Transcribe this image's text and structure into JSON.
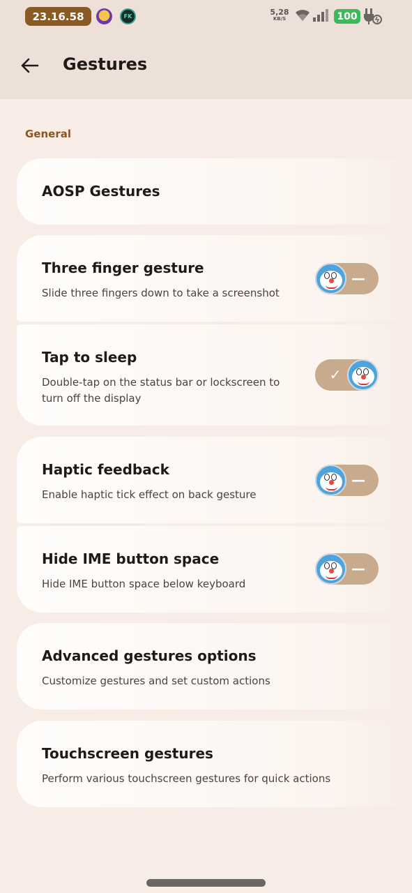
{
  "status_bar": {
    "time": "23.16.58",
    "net_speed_value": "5,28",
    "net_speed_unit": "KB/S",
    "battery_level": "100",
    "avatar2_text": "FK"
  },
  "header": {
    "title": "Gestures",
    "back_icon": "arrow-left-icon"
  },
  "section": {
    "label": "General"
  },
  "items": [
    {
      "title": "AOSP Gestures"
    },
    {
      "title": "Three finger gesture",
      "subtitle": "Slide three fingers down to take a screenshot",
      "toggle_on": false
    },
    {
      "title": "Tap to sleep",
      "subtitle": "Double-tap on the status bar or lockscreen to turn off the display",
      "toggle_on": true
    },
    {
      "title": "Haptic feedback",
      "subtitle": "Enable haptic tick effect on back gesture",
      "toggle_on": false
    },
    {
      "title": "Hide IME button space",
      "subtitle": "Hide IME button space below keyboard",
      "toggle_on": false
    },
    {
      "title": "Advanced gestures options",
      "subtitle": "Customize gestures and set custom actions"
    },
    {
      "title": "Touchscreen gestures",
      "subtitle": "Perform various touchscreen gestures for quick actions"
    }
  ],
  "colors": {
    "accent": "#8a5620",
    "toggle_track": "#c8ab8c",
    "battery": "#3cba5a"
  }
}
